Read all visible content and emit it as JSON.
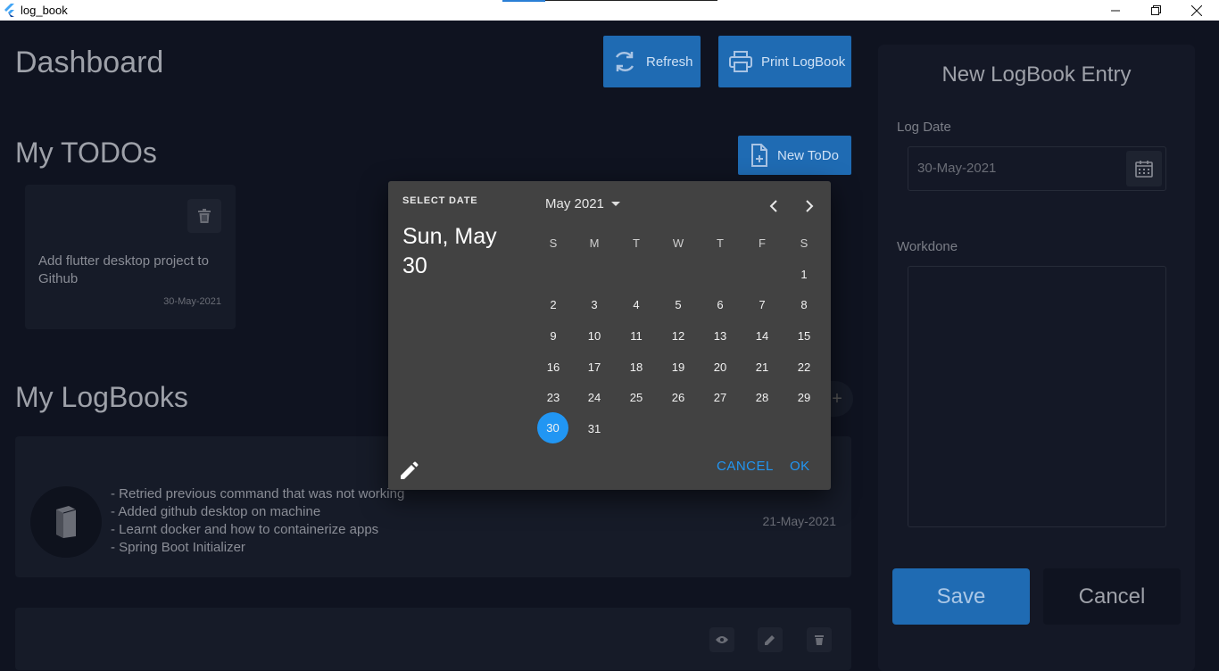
{
  "window": {
    "title": "log_book"
  },
  "dashboard": {
    "title": "Dashboard",
    "refresh_label": "Refresh",
    "print_label": "Print LogBook"
  },
  "todos": {
    "title": "My TODOs",
    "new_label": "New ToDo",
    "items": [
      {
        "text": "Add flutter desktop project to Github",
        "date": "30-May-2021"
      }
    ]
  },
  "logbooks": {
    "title": "My LogBooks",
    "items": [
      {
        "lines": [
          "- Retried previous command that  was not working",
          "- Added github desktop on machine",
          "- Learnt docker and how to containerize apps",
          "- Spring Boot Initializer"
        ],
        "date": "21-May-2021"
      }
    ]
  },
  "entry_panel": {
    "title": "New LogBook Entry",
    "log_date_label": "Log Date",
    "log_date_value": "30-May-2021",
    "workdone_label": "Workdone",
    "workdone_value": "",
    "save_label": "Save",
    "cancel_label": "Cancel"
  },
  "date_picker": {
    "header_label": "SELECT DATE",
    "selected_display": "Sun, May 30",
    "month_label": "May 2021",
    "weekdays": [
      "S",
      "M",
      "T",
      "W",
      "T",
      "F",
      "S"
    ],
    "first_weekday_index": 6,
    "days_in_month": 31,
    "selected_day": 30,
    "cancel_label": "CANCEL",
    "ok_label": "OK",
    "accent_color": "#2196f3"
  },
  "colors": {
    "background": "#0f1320",
    "primary_button": "#1f6bb3",
    "dialog": "#424242"
  }
}
